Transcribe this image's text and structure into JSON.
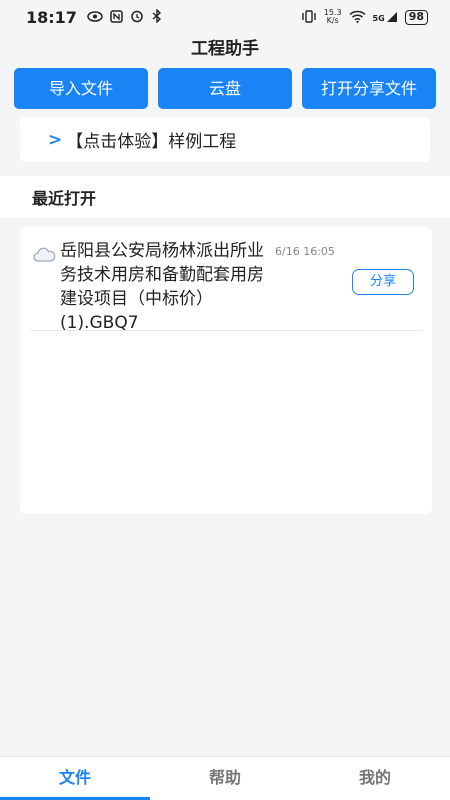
{
  "status_bar": {
    "time": "18:17",
    "left_icons": [
      "eye-icon",
      "nfc-icon",
      "alarm-icon",
      "bluetooth-icon"
    ],
    "net_speed_value": "15.3",
    "net_speed_unit": "K/s",
    "network": "5G",
    "battery": "98"
  },
  "header": {
    "title": "工程助手"
  },
  "actions": {
    "import_label": "导入文件",
    "cloud_label": "云盘",
    "open_share_label": "打开分享文件"
  },
  "sample": {
    "arrow": ">",
    "label": "【点击体验】样例工程"
  },
  "recent": {
    "title": "最近打开",
    "files": [
      {
        "icon": "cloud-icon",
        "name": "岳阳县公安局杨林派出所业务技术用房和备勤配套用房建设项目（中标价）(1).GBQ7",
        "time": "6/16 16:05",
        "share_label": "分享"
      }
    ]
  },
  "tabs": [
    {
      "label": "文件",
      "active": true
    },
    {
      "label": "帮助",
      "active": false
    },
    {
      "label": "我的",
      "active": false
    }
  ],
  "colors": {
    "accent": "#1a84f7",
    "background": "#f4f5f7"
  }
}
